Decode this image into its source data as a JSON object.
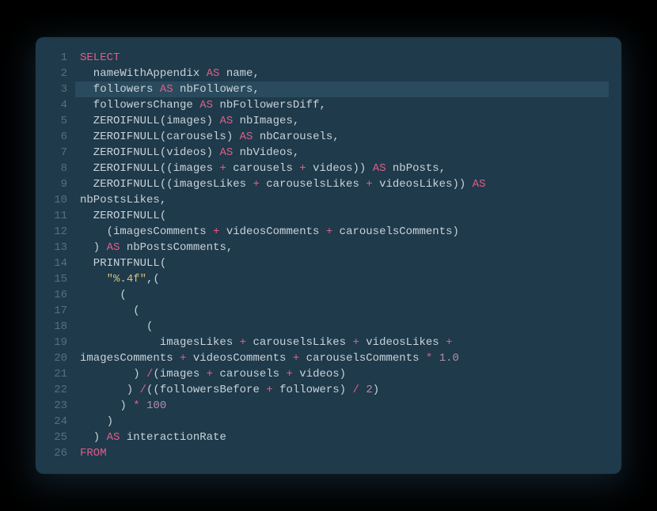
{
  "editor": {
    "highlighted_line": 3,
    "lines": [
      {
        "n": 1,
        "tokens": [
          {
            "t": "SELECT",
            "c": "kw"
          }
        ]
      },
      {
        "n": 2,
        "tokens": [
          {
            "t": "  nameWithAppendix ",
            "c": "id"
          },
          {
            "t": "AS",
            "c": "kw"
          },
          {
            "t": " name,",
            "c": "id"
          }
        ]
      },
      {
        "n": 3,
        "tokens": [
          {
            "t": "  followers ",
            "c": "id"
          },
          {
            "t": "AS",
            "c": "kw"
          },
          {
            "t": " nbFollowers,",
            "c": "id"
          }
        ]
      },
      {
        "n": 4,
        "tokens": [
          {
            "t": "  followersChange ",
            "c": "id"
          },
          {
            "t": "AS",
            "c": "kw"
          },
          {
            "t": " nbFollowersDiff,",
            "c": "id"
          }
        ]
      },
      {
        "n": 5,
        "tokens": [
          {
            "t": "  ZEROIFNULL(images) ",
            "c": "id"
          },
          {
            "t": "AS",
            "c": "kw"
          },
          {
            "t": " nbImages,",
            "c": "id"
          }
        ]
      },
      {
        "n": 6,
        "tokens": [
          {
            "t": "  ZEROIFNULL(carousels) ",
            "c": "id"
          },
          {
            "t": "AS",
            "c": "kw"
          },
          {
            "t": " nbCarousels,",
            "c": "id"
          }
        ]
      },
      {
        "n": 7,
        "tokens": [
          {
            "t": "  ZEROIFNULL(videos) ",
            "c": "id"
          },
          {
            "t": "AS",
            "c": "kw"
          },
          {
            "t": " nbVideos,",
            "c": "id"
          }
        ]
      },
      {
        "n": 8,
        "tokens": [
          {
            "t": "  ZEROIFNULL((images ",
            "c": "id"
          },
          {
            "t": "+",
            "c": "op"
          },
          {
            "t": " carousels ",
            "c": "id"
          },
          {
            "t": "+",
            "c": "op"
          },
          {
            "t": " videos)) ",
            "c": "id"
          },
          {
            "t": "AS",
            "c": "kw"
          },
          {
            "t": " nbPosts,",
            "c": "id"
          }
        ]
      },
      {
        "n": 9,
        "tokens": [
          {
            "t": "  ZEROIFNULL((imagesLikes ",
            "c": "id"
          },
          {
            "t": "+",
            "c": "op"
          },
          {
            "t": " carouselsLikes ",
            "c": "id"
          },
          {
            "t": "+",
            "c": "op"
          },
          {
            "t": " videosLikes)) ",
            "c": "id"
          },
          {
            "t": "AS",
            "c": "kw"
          }
        ]
      },
      {
        "n": 10,
        "tokens": [
          {
            "t": "nbPostsLikes,",
            "c": "id"
          }
        ]
      },
      {
        "n": 11,
        "tokens": [
          {
            "t": "  ZEROIFNULL(",
            "c": "id"
          }
        ]
      },
      {
        "n": 12,
        "tokens": [
          {
            "t": "    (imagesComments ",
            "c": "id"
          },
          {
            "t": "+",
            "c": "op"
          },
          {
            "t": " videosComments ",
            "c": "id"
          },
          {
            "t": "+",
            "c": "op"
          },
          {
            "t": " carouselsComments)",
            "c": "id"
          }
        ]
      },
      {
        "n": 13,
        "tokens": [
          {
            "t": "  ) ",
            "c": "id"
          },
          {
            "t": "AS",
            "c": "kw"
          },
          {
            "t": " nbPostsComments,",
            "c": "id"
          }
        ]
      },
      {
        "n": 14,
        "tokens": [
          {
            "t": "  PRINTFNULL(",
            "c": "id"
          }
        ]
      },
      {
        "n": 15,
        "tokens": [
          {
            "t": "    ",
            "c": "id"
          },
          {
            "t": "\"%.4f\"",
            "c": "str"
          },
          {
            "t": ",(",
            "c": "id"
          }
        ]
      },
      {
        "n": 16,
        "tokens": [
          {
            "t": "      (",
            "c": "id"
          }
        ]
      },
      {
        "n": 17,
        "tokens": [
          {
            "t": "        (",
            "c": "id"
          }
        ]
      },
      {
        "n": 18,
        "tokens": [
          {
            "t": "          (",
            "c": "id"
          }
        ]
      },
      {
        "n": 19,
        "tokens": [
          {
            "t": "            imagesLikes ",
            "c": "id"
          },
          {
            "t": "+",
            "c": "op"
          },
          {
            "t": " carouselsLikes ",
            "c": "id"
          },
          {
            "t": "+",
            "c": "op"
          },
          {
            "t": " videosLikes ",
            "c": "id"
          },
          {
            "t": "+",
            "c": "op"
          }
        ]
      },
      {
        "n": 20,
        "tokens": [
          {
            "t": "imagesComments ",
            "c": "id"
          },
          {
            "t": "+",
            "c": "op"
          },
          {
            "t": " videosComments ",
            "c": "id"
          },
          {
            "t": "+",
            "c": "op"
          },
          {
            "t": " carouselsComments ",
            "c": "id"
          },
          {
            "t": "*",
            "c": "op"
          },
          {
            "t": " ",
            "c": "id"
          },
          {
            "t": "1.0",
            "c": "num"
          }
        ]
      },
      {
        "n": 21,
        "tokens": [
          {
            "t": "        ) ",
            "c": "id"
          },
          {
            "t": "/",
            "c": "op"
          },
          {
            "t": "(images ",
            "c": "id"
          },
          {
            "t": "+",
            "c": "op"
          },
          {
            "t": " carousels ",
            "c": "id"
          },
          {
            "t": "+",
            "c": "op"
          },
          {
            "t": " videos)",
            "c": "id"
          }
        ]
      },
      {
        "n": 22,
        "tokens": [
          {
            "t": "       ) ",
            "c": "id"
          },
          {
            "t": "/",
            "c": "op"
          },
          {
            "t": "((followersBefore ",
            "c": "id"
          },
          {
            "t": "+",
            "c": "op"
          },
          {
            "t": " followers) ",
            "c": "id"
          },
          {
            "t": "/",
            "c": "op"
          },
          {
            "t": " ",
            "c": "id"
          },
          {
            "t": "2",
            "c": "num"
          },
          {
            "t": ")",
            "c": "id"
          }
        ]
      },
      {
        "n": 23,
        "tokens": [
          {
            "t": "      ) ",
            "c": "id"
          },
          {
            "t": "*",
            "c": "op"
          },
          {
            "t": " ",
            "c": "id"
          },
          {
            "t": "100",
            "c": "num"
          }
        ]
      },
      {
        "n": 24,
        "tokens": [
          {
            "t": "    )",
            "c": "id"
          }
        ]
      },
      {
        "n": 25,
        "tokens": [
          {
            "t": "  ) ",
            "c": "id"
          },
          {
            "t": "AS",
            "c": "kw"
          },
          {
            "t": " interactionRate",
            "c": "id"
          }
        ]
      },
      {
        "n": 26,
        "tokens": [
          {
            "t": "FROM",
            "c": "kw"
          }
        ]
      }
    ]
  }
}
